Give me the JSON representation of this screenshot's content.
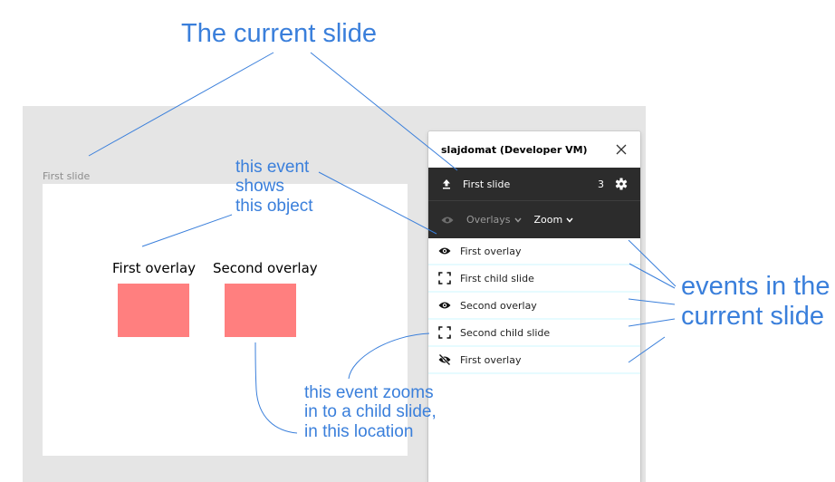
{
  "canvas": {
    "frame_label": "First slide",
    "objects": [
      {
        "label": "First overlay"
      },
      {
        "label": "Second overlay"
      }
    ],
    "object_fill": "#ff7f7f"
  },
  "panel": {
    "title": "slajdomat (Developer VM)",
    "current_slide": {
      "name": "First slide",
      "count": "3",
      "icon": "upload-icon",
      "settings_icon": "gear-icon"
    },
    "filters": {
      "visibility_icon": "eye-icon",
      "overlays_label": "Overlays",
      "zoom_label": "Zoom"
    },
    "events": [
      {
        "icon": "eye-icon",
        "label": "First overlay"
      },
      {
        "icon": "expand-icon",
        "label": "First child slide"
      },
      {
        "icon": "eye-icon",
        "label": "Second overlay"
      },
      {
        "icon": "expand-icon",
        "label": "Second child slide"
      },
      {
        "icon": "eye-off-icon",
        "label": "First overlay"
      }
    ],
    "dark_bg": "#2c2c2c",
    "row_divider": "#e6fbff"
  },
  "annotations": {
    "title": "The current slide",
    "shows_object": [
      "this event",
      "shows",
      "this object"
    ],
    "events_label": [
      "events in the",
      "current slide"
    ],
    "zoom_child": [
      "this event zooms",
      "in to a child slide,",
      "in this location"
    ],
    "color": "#3a7fdb"
  }
}
